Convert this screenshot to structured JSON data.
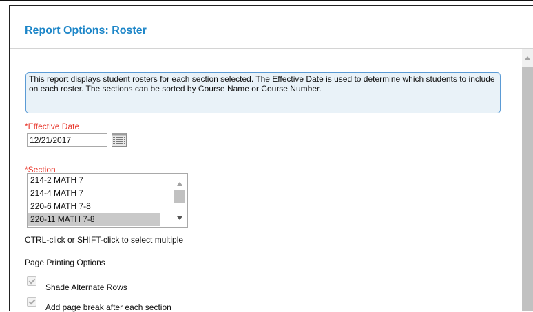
{
  "dialog": {
    "title": "Report Options: Roster"
  },
  "info_text": "This report displays student rosters for each section selected. The Effective Date is used to determine which students to include on each roster. The sections can be sorted by Course Name or Course Number.",
  "effective_date": {
    "label": "*Effective Date",
    "value": "12/21/2017"
  },
  "section": {
    "label": "*Section",
    "options": [
      "214-2 MATH 7",
      "214-4 MATH 7",
      "220-6 MATH 7-8",
      "220-11 MATH 7-8"
    ],
    "selected": "220-11 MATH 7-8",
    "hint": "CTRL-click or SHIFT-click to select multiple"
  },
  "printing": {
    "label": "Page Printing Options",
    "options": [
      {
        "label": "Shade Alternate Rows",
        "checked": true
      },
      {
        "label": "Add page break after each section",
        "checked": true
      }
    ]
  },
  "colors": {
    "title": "#1d86c8",
    "required": "#e8382d",
    "info_border": "#5b9bd5",
    "info_bg": "#e9f2f8"
  }
}
